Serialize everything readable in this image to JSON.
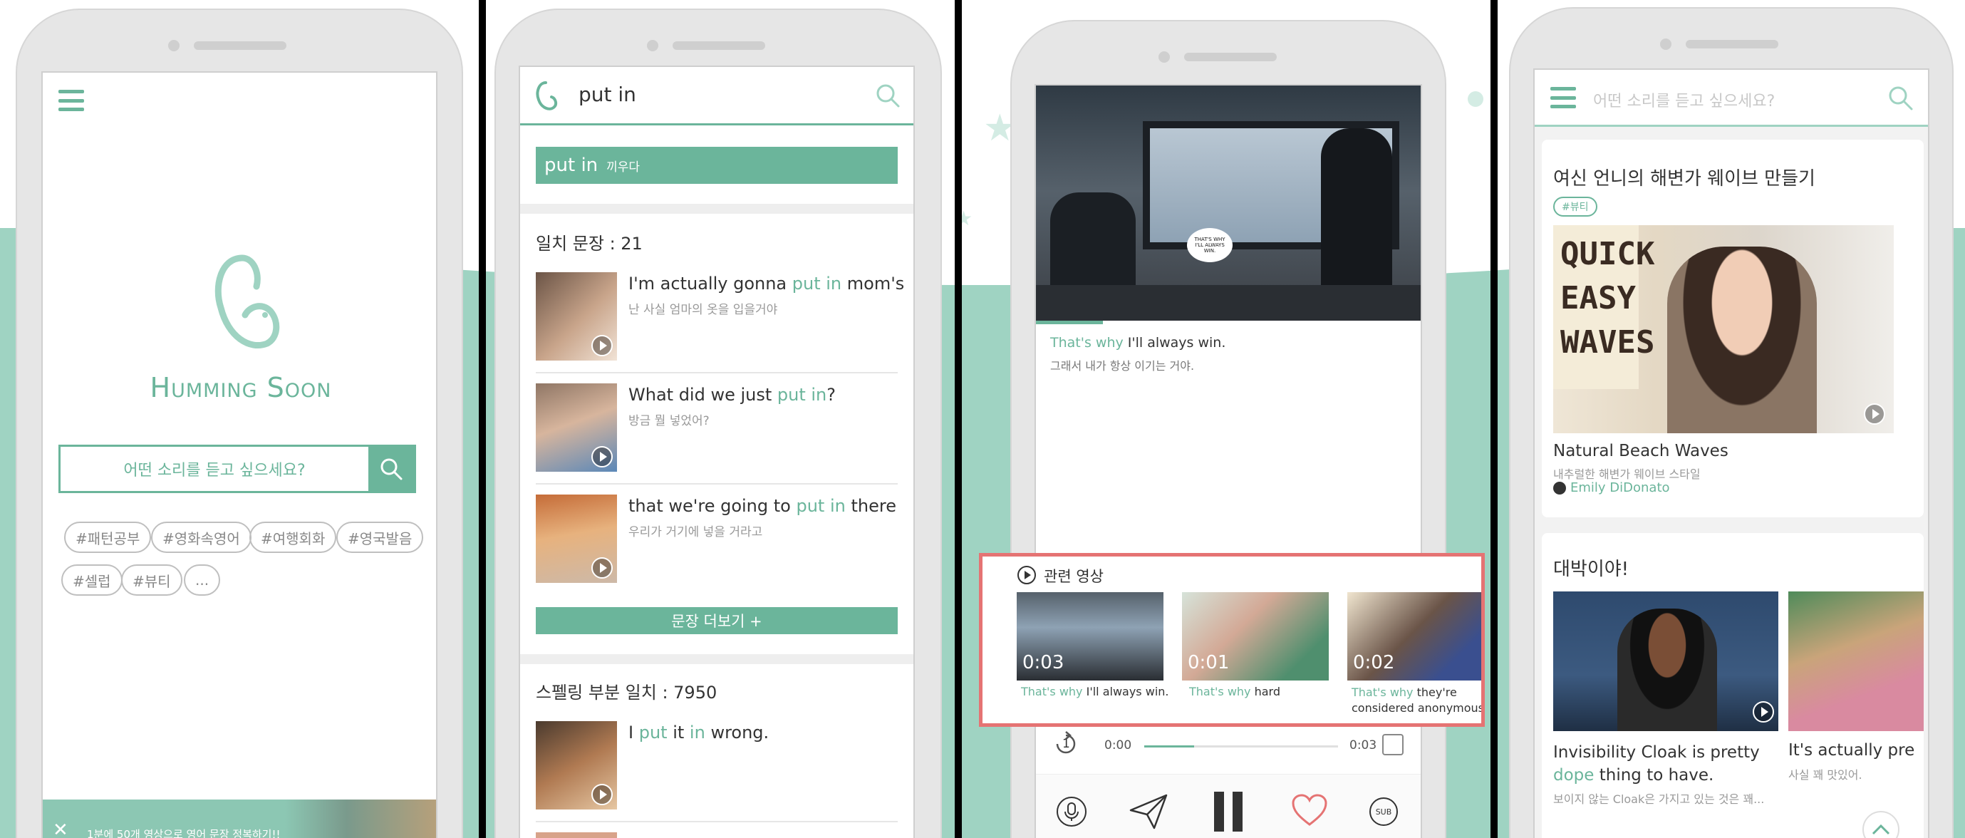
{
  "phone1": {
    "brand": "Humming Soon",
    "search_placeholder": "어떤 소리를 듣고 싶으세요?",
    "tags": [
      "#패턴공부",
      "#영화속영어",
      "#여행회화",
      "#영국발음",
      "#셀럽",
      "#뷰티",
      "..."
    ],
    "banner_text": "1분에 50개 영상으로 영어 문장 정복하기!!"
  },
  "phone2": {
    "query": "put in",
    "definition": {
      "word": "put in",
      "meaning": "끼우다"
    },
    "match_header": "일치 문장 : 21",
    "results": [
      {
        "pre": "I'm actually gonna ",
        "hl": "put in",
        "post": " mom's",
        "kr": "난 사실 엄마의 옷을 입을거야"
      },
      {
        "pre": "What did we just ",
        "hl": "put in",
        "post": "?",
        "kr": "방금 뭘 넣었어?"
      },
      {
        "pre": "that we're going to ",
        "hl": "put in",
        "post": " there",
        "kr": "우리가 거기에 넣을 거라고"
      }
    ],
    "more_button": "문장 더보기 +",
    "partial_header": "스펠링 부분 일치 : 7950",
    "partial_result": {
      "w1": "I ",
      "h1": "put",
      "w2": " it ",
      "h2": "in",
      "w3": " wrong."
    }
  },
  "phone3": {
    "speech_bubble": "THAT'S WHY I'LL ALWAYS WIN.",
    "subtitle_hl": "That's why",
    "subtitle_rest": " I'll always win.",
    "subtitle_kr": "그래서 내가 항상 이기는 거야.",
    "related_title": "관련 영상",
    "related": [
      {
        "time": "0:03",
        "hl": "That's why",
        "rest": " I'll always win."
      },
      {
        "time": "0:01",
        "hl": "That's why",
        "rest": " hard"
      },
      {
        "time": "0:02",
        "hl": "That's why",
        "rest": " they're considered anonymous"
      }
    ],
    "player": {
      "loop_count": "1",
      "current": "0:00",
      "total": "0:03",
      "sub_label": "SUB"
    }
  },
  "phone4": {
    "search_placeholder": "어떤 소리를 듣고 싶으세요?",
    "card1": {
      "title": "여신 언니의 해변가 웨이브 만들기",
      "tag": "#뷰티",
      "overlay_lines": [
        "QUICK",
        "EASY",
        "WAVES"
      ],
      "video_title": "Natural Beach Waves",
      "video_sub": "내추럴한 해변가 웨이브 스타일",
      "author": "Emily DiDonato"
    },
    "card2": {
      "title": "대박이야!",
      "v1_line1": "Invisibility Cloak is pretty",
      "v1_hl": "dope",
      "v1_line2": " thing to have.",
      "v1_kr": "보이지 않는 Cloak은 가지고 있는 것은 꽤...",
      "v2_line1": "It's actually pre",
      "v2_kr": "사실 꽤 맛있어."
    }
  },
  "colors": {
    "accent": "#6bb59b",
    "highlight_box": "#e57373",
    "background_wave": "#9fd3c2"
  }
}
